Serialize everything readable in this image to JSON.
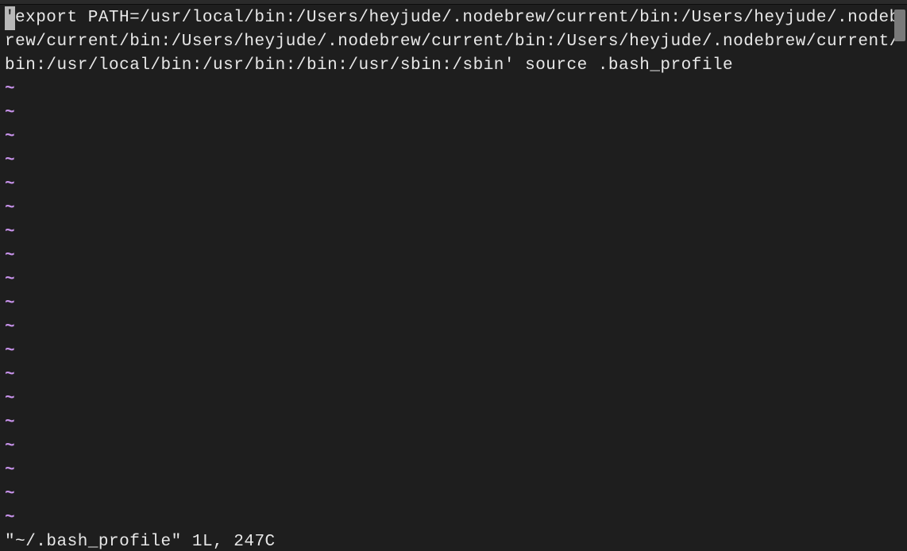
{
  "editor": {
    "cursor_char": "'",
    "content": "export PATH=/usr/local/bin:/Users/heyjude/.nodebrew/current/bin:/Users/heyjude/.nodebrew/current/bin:/Users/heyjude/.nodebrew/current/bin:/Users/heyjude/.nodebrew/current/bin:/usr/local/bin:/usr/bin:/bin:/usr/sbin:/sbin' source .bash_profile",
    "tilde": "~",
    "tilde_count": 19
  },
  "status": {
    "text": "\"~/.bash_profile\" 1L, 247C"
  }
}
